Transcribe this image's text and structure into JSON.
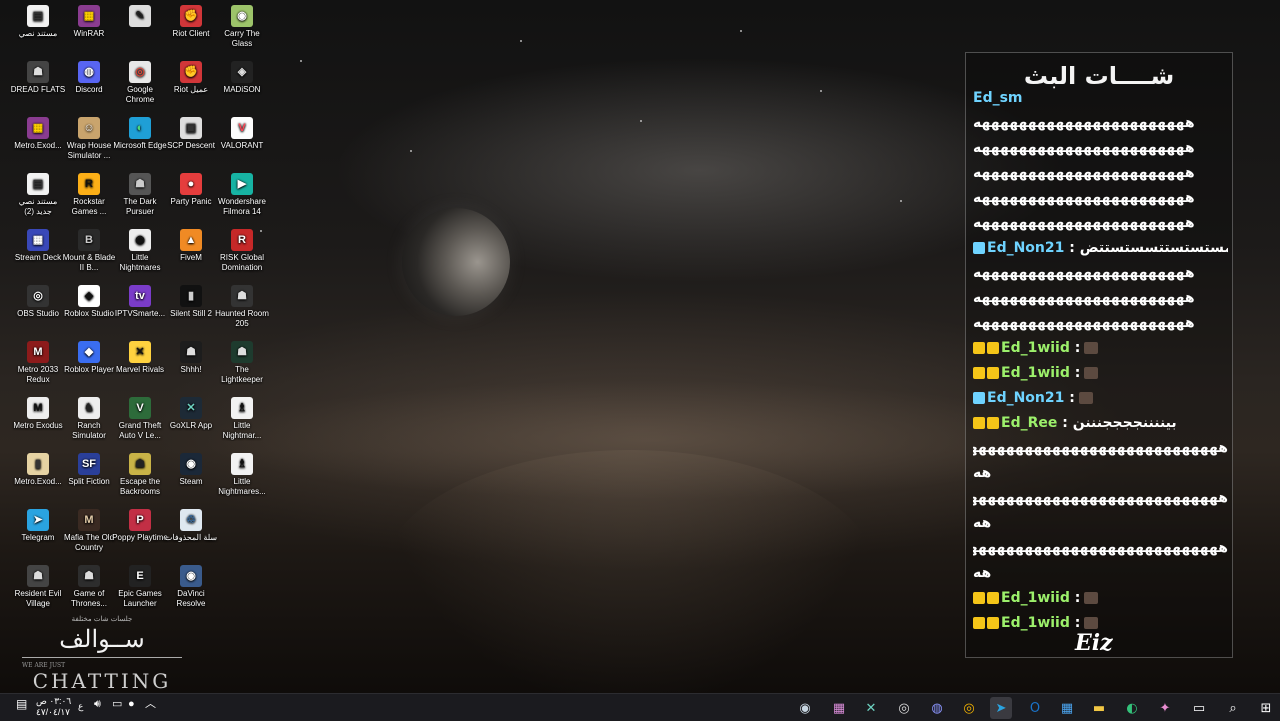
{
  "desktop_icons": [
    {
      "label": "مستند نصي",
      "glyph": "▤",
      "bg": "#f2f2f2",
      "fg": "#333"
    },
    {
      "label": "WinRAR",
      "glyph": "▦",
      "bg": "#8a3c90",
      "fg": "#ffd000"
    },
    {
      "label": "",
      "glyph": "✎",
      "bg": "#dddddd",
      "fg": "#222"
    },
    {
      "label": "Riot Client",
      "glyph": "✊",
      "bg": "#d13639",
      "fg": "#fff"
    },
    {
      "label": "Carry The Glass",
      "glyph": "◉",
      "bg": "#9dc46a",
      "fg": "#fff"
    },
    {
      "label": "DREAD FLATS",
      "glyph": "☗",
      "bg": "#444",
      "fg": "#ddd"
    },
    {
      "label": "Discord",
      "glyph": "◍",
      "bg": "#5865f2",
      "fg": "#fff"
    },
    {
      "label": "Google Chrome",
      "glyph": "◎",
      "bg": "#e8e8e8",
      "fg": "#db4437"
    },
    {
      "label": "Riot عميل",
      "glyph": "✊",
      "bg": "#d13639",
      "fg": "#fff"
    },
    {
      "label": "MADiSON",
      "glyph": "◈",
      "bg": "#222",
      "fg": "#ddd"
    },
    {
      "label": "Metro.Exod...",
      "glyph": "▦",
      "bg": "#8a3c90",
      "fg": "#ffd000"
    },
    {
      "label": "Wrap House Simulator ...",
      "glyph": "☺",
      "bg": "#c9a46d",
      "fg": "#fff"
    },
    {
      "label": "Microsoft Edge",
      "glyph": "◐",
      "bg": "#1f9fd6",
      "fg": "#4ce07a"
    },
    {
      "label": "SCP Descent",
      "glyph": "▣",
      "bg": "#dedede",
      "fg": "#333"
    },
    {
      "label": "VALORANT",
      "glyph": "V",
      "bg": "#fdfdfd",
      "fg": "#ff4655"
    },
    {
      "label": "مستند نصي جديد (2)",
      "glyph": "▤",
      "bg": "#f2f2f2",
      "fg": "#333"
    },
    {
      "label": "Rockstar Games ...",
      "glyph": "R",
      "bg": "#fcaf17",
      "fg": "#111"
    },
    {
      "label": "The Dark Pursuer",
      "glyph": "☗",
      "bg": "#555",
      "fg": "#ccc"
    },
    {
      "label": "Party Panic",
      "glyph": "●",
      "bg": "#e53d3d",
      "fg": "#fff"
    },
    {
      "label": "Wondershare Filmora 14",
      "glyph": "▶",
      "bg": "#17b3a3",
      "fg": "#fff"
    },
    {
      "label": "Stream Deck",
      "glyph": "▦",
      "bg": "#3948b8",
      "fg": "#fff"
    },
    {
      "label": "Mount & Blade II B...",
      "glyph": "B",
      "bg": "#2a2a2a",
      "fg": "#ccc"
    },
    {
      "label": "Little Nightmares",
      "glyph": "◉",
      "bg": "#eeeeee",
      "fg": "#111"
    },
    {
      "label": "FiveM",
      "glyph": "▲",
      "bg": "#f08a24",
      "fg": "#fff"
    },
    {
      "label": "RISK Global Domination",
      "glyph": "R",
      "bg": "#c62828",
      "fg": "#fff"
    },
    {
      "label": "OBS Studio",
      "glyph": "◎",
      "bg": "#333",
      "fg": "#fff"
    },
    {
      "label": "Roblox Studio",
      "glyph": "◆",
      "bg": "#ffffff",
      "fg": "#111"
    },
    {
      "label": "IPTVSmarte...",
      "glyph": "tv",
      "bg": "#7a3cc9",
      "fg": "#fff"
    },
    {
      "label": "Silent Still 2",
      "glyph": "▮",
      "bg": "#111",
      "fg": "#ccc"
    },
    {
      "label": "Haunted Room  205",
      "glyph": "☗",
      "bg": "#333",
      "fg": "#ddd"
    },
    {
      "label": "Metro 2033 Redux",
      "glyph": "M",
      "bg": "#8c1b1b",
      "fg": "#fff"
    },
    {
      "label": "Roblox Player",
      "glyph": "◆",
      "bg": "#3a6df0",
      "fg": "#fff"
    },
    {
      "label": "Marvel Rivals",
      "glyph": "✕",
      "bg": "#ffd23f",
      "fg": "#111"
    },
    {
      "label": "Shhh!",
      "glyph": "☗",
      "bg": "#1d1d1d",
      "fg": "#ddd"
    },
    {
      "label": "The Lightkeeper",
      "glyph": "☗",
      "bg": "#1e3b2e",
      "fg": "#ddd"
    },
    {
      "label": "Metro Exodus",
      "glyph": "M",
      "bg": "#eeeeee",
      "fg": "#111"
    },
    {
      "label": "Ranch Simulator",
      "glyph": "♞",
      "bg": "#eeeeee",
      "fg": "#222"
    },
    {
      "label": "Grand Theft Auto V Le...",
      "glyph": "V",
      "bg": "#2d6b3a",
      "fg": "#fff"
    },
    {
      "label": "GoXLR App",
      "glyph": "✕",
      "bg": "#1d2a36",
      "fg": "#6ed3c2"
    },
    {
      "label": "Little Nightmar...",
      "glyph": "♗",
      "bg": "#f2f2f2",
      "fg": "#111"
    },
    {
      "label": "Metro.Exod...",
      "glyph": "▮",
      "bg": "#e6d3a3",
      "fg": "#333"
    },
    {
      "label": "Split Fiction",
      "glyph": "SF",
      "bg": "#2a3f9a",
      "fg": "#fff"
    },
    {
      "label": "Escape the Backrooms",
      "glyph": "☗",
      "bg": "#c9b347",
      "fg": "#222"
    },
    {
      "label": "Steam",
      "glyph": "◉",
      "bg": "#1b2838",
      "fg": "#fff"
    },
    {
      "label": "Little Nightmares...",
      "glyph": "♗",
      "bg": "#f2f2f2",
      "fg": "#111"
    },
    {
      "label": "Telegram",
      "glyph": "➤",
      "bg": "#2aa3e0",
      "fg": "#fff"
    },
    {
      "label": "Mafia The Old Country",
      "glyph": "M",
      "bg": "#3a2a22",
      "fg": "#e0c9a6"
    },
    {
      "label": "Poppy Playtime",
      "glyph": "P",
      "bg": "#c22f45",
      "fg": "#fff"
    },
    {
      "label": "سلة المحذوفات",
      "glyph": "♲",
      "bg": "#dfe8f0",
      "fg": "#3a6da1"
    },
    {
      "label": "",
      "glyph": "",
      "bg": "transparent",
      "fg": "#fff"
    },
    {
      "label": "Resident Evil Village",
      "glyph": "☗",
      "bg": "#444",
      "fg": "#ddd"
    },
    {
      "label": "Game of Thrones...",
      "glyph": "☗",
      "bg": "#2d2d2d",
      "fg": "#ddd"
    },
    {
      "label": "Epic Games Launcher",
      "glyph": "E",
      "bg": "#222",
      "fg": "#fff"
    },
    {
      "label": "DaVinci Resolve",
      "glyph": "◉",
      "bg": "#3a5b8c",
      "fg": "#fff"
    },
    {
      "label": "",
      "glyph": "",
      "bg": "transparent",
      "fg": "#fff"
    }
  ],
  "branding": {
    "tagline_ar": "جلسات شات مختلفة",
    "title_ar": "ســوالف",
    "tagline_en": "WE ARE JUST",
    "title_en": "CHATTING"
  },
  "chat": {
    "title": "شــــات البث",
    "logo": "Eiz",
    "lines": [
      {
        "type": "text",
        "user": "Ed_sm",
        "msg": "",
        "cls": "uname"
      },
      {
        "type": "text",
        "user": "",
        "msg": "هههههههههههههههههههههههه"
      },
      {
        "type": "text",
        "user": "",
        "msg": "هههههههههههههههههههههههه"
      },
      {
        "type": "text",
        "user": "",
        "msg": "هههههههههههههههههههههههه"
      },
      {
        "type": "text",
        "user": "",
        "msg": "هههههههههههههههههههههههه"
      },
      {
        "type": "text",
        "user": "",
        "msg": "هههههههههههههههههههههههه"
      },
      {
        "type": "user",
        "user": "Ed_Non21",
        "msg": ": مستستستتسستستتض",
        "green": false
      },
      {
        "type": "text",
        "user": "",
        "msg": "هههههههههههههههههههههههه"
      },
      {
        "type": "text",
        "user": "",
        "msg": "هههههههههههههههههههههههه"
      },
      {
        "type": "text",
        "user": "",
        "msg": "هههههههههههههههههههههههه"
      },
      {
        "type": "user",
        "user": "Ed_1wiid",
        "msg": ":",
        "green": true
      },
      {
        "type": "user",
        "user": "Ed_1wiid",
        "msg": ":",
        "green": true
      },
      {
        "type": "user",
        "user": "Ed_Non21",
        "msg": ":",
        "green": false
      },
      {
        "type": "user",
        "user": "Ed_Ree",
        "msg": ": بيننننججججنننن",
        "green": true
      },
      {
        "type": "text",
        "user": "",
        "msg": "هههههههههههههههههههههههههههههه"
      },
      {
        "type": "text",
        "user": "",
        "msg": "هه"
      },
      {
        "type": "text",
        "user": "",
        "msg": "هههههههههههههههههههههههههههههه"
      },
      {
        "type": "text",
        "user": "",
        "msg": "هه"
      },
      {
        "type": "text",
        "user": "",
        "msg": "هههههههههههههههههههههههههههههه"
      },
      {
        "type": "text",
        "user": "",
        "msg": "هه"
      },
      {
        "type": "user",
        "user": "Ed_1wiid",
        "msg": ":",
        "green": true
      },
      {
        "type": "user",
        "user": "Ed_1wiid",
        "msg": ":",
        "green": true
      }
    ]
  },
  "taskbar": {
    "clock_time": "٠٣:٠٦ ص",
    "clock_date": "٤٧/٠٤/١٧",
    "lang": "ع",
    "apps": [
      {
        "name": "steam-taskbar-icon",
        "glyph": "◉",
        "color": "#c7d5e0"
      },
      {
        "name": "winrar-taskbar-icon",
        "glyph": "▦",
        "color": "#d98cd8"
      },
      {
        "name": "goxlr-taskbar-icon",
        "glyph": "✕",
        "color": "#6ed3c2"
      },
      {
        "name": "obs-taskbar-icon",
        "glyph": "◎",
        "color": "#ddd"
      },
      {
        "name": "discord-taskbar-icon",
        "glyph": "◍",
        "color": "#8c96ff"
      },
      {
        "name": "chrome-taskbar-icon",
        "glyph": "◎",
        "color": "#f4b400"
      },
      {
        "name": "telegram-taskbar-icon",
        "glyph": "➤",
        "color": "#2aa3e0"
      },
      {
        "name": "outlook-taskbar-icon",
        "glyph": "O",
        "color": "#1a73c9"
      },
      {
        "name": "store-taskbar-icon",
        "glyph": "▦",
        "color": "#4ba5f0"
      },
      {
        "name": "file-explorer-taskbar-icon",
        "glyph": "▬",
        "color": "#f2c744"
      },
      {
        "name": "edge-taskbar-icon",
        "glyph": "◐",
        "color": "#33c27a"
      },
      {
        "name": "copilot-taskbar-icon",
        "glyph": "✦",
        "color": "#e98dd1"
      },
      {
        "name": "task-view-taskbar-icon",
        "glyph": "▭",
        "color": "#fff"
      },
      {
        "name": "search-taskbar-icon",
        "glyph": "⌕",
        "color": "#fff"
      },
      {
        "name": "start-taskbar-icon",
        "glyph": "⊞",
        "color": "#fff"
      }
    ]
  }
}
